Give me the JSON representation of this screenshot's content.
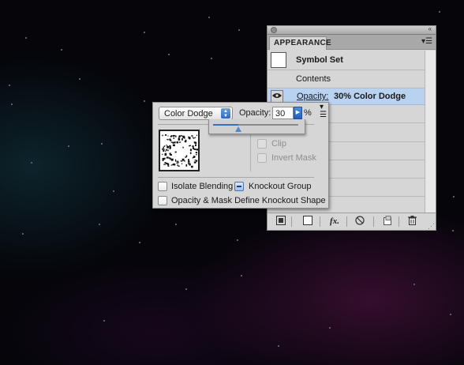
{
  "appearance_panel": {
    "tab_label": "APPEARANCE",
    "menu_icon": "panel-menu-icon",
    "collapse_icon": "double-arrow-icon",
    "rows": [
      {
        "type": "symbol",
        "label": "Symbol Set"
      },
      {
        "type": "contents",
        "label": "Contents"
      },
      {
        "type": "opacity",
        "label": "Opacity:",
        "value": "30% Color Dodge",
        "selected": true
      }
    ],
    "toolbar_icons": [
      "new-art-basic-appearance-icon",
      "clear-appearance-icon",
      "fx-icon",
      "reduce-icon",
      "duplicate-item-icon",
      "trash-icon"
    ],
    "fx_label": "fx."
  },
  "transparency_popup": {
    "blend_mode": "Color Dodge",
    "opacity_label": "Opacity:",
    "opacity_value": "30",
    "percent": "%",
    "slider_value_percent": 30,
    "clip_label": "Clip",
    "invert_mask_label": "Invert Mask",
    "isolate_blending_label": "Isolate Blending",
    "knockout_group_label": "Knockout Group",
    "opacity_mask_label": "Opacity & Mask Define Knockout Shape"
  },
  "colors": {
    "selection_row": "#b8d2f0",
    "panel_bg": "#d6d6d6",
    "accent_blue": "#2c69c6"
  }
}
